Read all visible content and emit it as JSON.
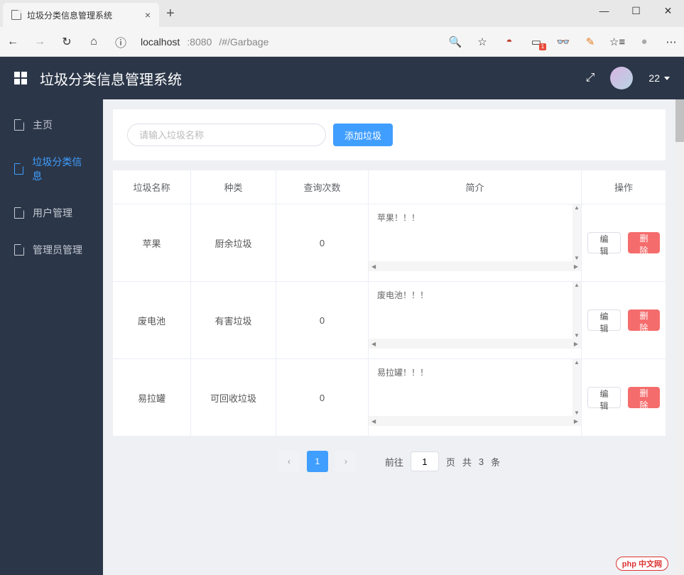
{
  "browser": {
    "tab_title": "垃圾分类信息管理系统",
    "url_protocol": "localhost",
    "url_port": ":8080",
    "url_path": "/#/Garbage"
  },
  "header": {
    "app_title": "垃圾分类信息管理系统",
    "user_count": "22"
  },
  "sidebar": {
    "items": [
      {
        "label": "主页"
      },
      {
        "label": "垃圾分类信息"
      },
      {
        "label": "用户管理"
      },
      {
        "label": "管理员管理"
      }
    ]
  },
  "search": {
    "placeholder": "请输入垃圾名称",
    "add_btn": "添加垃圾"
  },
  "table": {
    "headers": {
      "name": "垃圾名称",
      "type": "种类",
      "count": "查询次数",
      "desc": "简介",
      "ops": "操作"
    },
    "rows": [
      {
        "name": "苹果",
        "type": "厨余垃圾",
        "count": "0",
        "desc": "苹果！！！"
      },
      {
        "name": "废电池",
        "type": "有害垃圾",
        "count": "0",
        "desc": "废电池！！！"
      },
      {
        "name": "易拉罐",
        "type": "可回收垃圾",
        "count": "0",
        "desc": "易拉罐！！！"
      }
    ],
    "edit_label": "编辑",
    "delete_label": "删除"
  },
  "pagination": {
    "current": "1",
    "goto_prefix": "前往",
    "goto_value": "1",
    "goto_suffix": "页",
    "total_prefix": "共",
    "total_count": "3",
    "total_suffix": "条"
  },
  "watermark": "php 中文网"
}
